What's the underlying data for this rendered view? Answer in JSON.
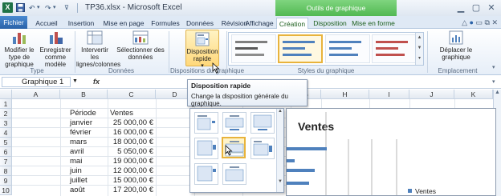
{
  "window": {
    "title": "TP36.xlsx - Microsoft Excel",
    "context_tools": "Outils de graphique",
    "controls": [
      "minimize-icon",
      "maximize-icon",
      "close-icon"
    ]
  },
  "tabs": [
    {
      "label": "Fichier"
    },
    {
      "label": "Accueil"
    },
    {
      "label": "Insertion"
    },
    {
      "label": "Mise en page"
    },
    {
      "label": "Formules"
    },
    {
      "label": "Données"
    },
    {
      "label": "Révision"
    },
    {
      "label": "Affichage"
    },
    {
      "label": "Création",
      "active": true
    },
    {
      "label": "Disposition"
    },
    {
      "label": "Mise en forme"
    }
  ],
  "ribbon": {
    "type_group": {
      "label": "Type",
      "change_type": "Modifier le type de graphique",
      "save_template": "Enregistrer comme modèle"
    },
    "data_group": {
      "label": "Données",
      "switch_rowcol": "Intervertir les lignes/colonnes",
      "select_data": "Sélectionner des données"
    },
    "layouts_group": {
      "label": "Dispositions du graphique",
      "quick_layout": "Disposition rapide"
    },
    "styles_group": {
      "label": "Styles du graphique"
    },
    "location_group": {
      "label": "Emplacement",
      "move_chart": "Déplacer le graphique"
    }
  },
  "formula_bar": {
    "name_box": "Graphique 1",
    "fx": "fx",
    "value": ""
  },
  "tooltip": {
    "title": "Disposition rapide",
    "description": "Change la disposition générale du graphique."
  },
  "columns": [
    "A",
    "B",
    "C",
    "D",
    "E",
    "F",
    "G",
    "H",
    "I",
    "J",
    "K"
  ],
  "rows": [
    "1",
    "2",
    "3",
    "4",
    "5",
    "6",
    "7",
    "8",
    "9",
    "10"
  ],
  "table": {
    "headers": [
      "Période",
      "Ventes"
    ],
    "data": [
      [
        "janvier",
        "25 000,00 €"
      ],
      [
        "février",
        "16 000,00 €"
      ],
      [
        "mars",
        "18 000,00 €"
      ],
      [
        "avril",
        "5 050,00 €"
      ],
      [
        "mai",
        "19 000,00 €"
      ],
      [
        "juin",
        "12 000,00 €"
      ],
      [
        "juillet",
        "15 000,00 €"
      ],
      [
        "août",
        "17 200,00 €"
      ]
    ]
  },
  "chart": {
    "title": "Ventes",
    "legend": "Ventes"
  },
  "colors": {
    "accent_green": "#52b852",
    "excel_green": "#1f7246",
    "bar_blue": "#4f81bd",
    "selection_gold": "#e8b33c"
  }
}
